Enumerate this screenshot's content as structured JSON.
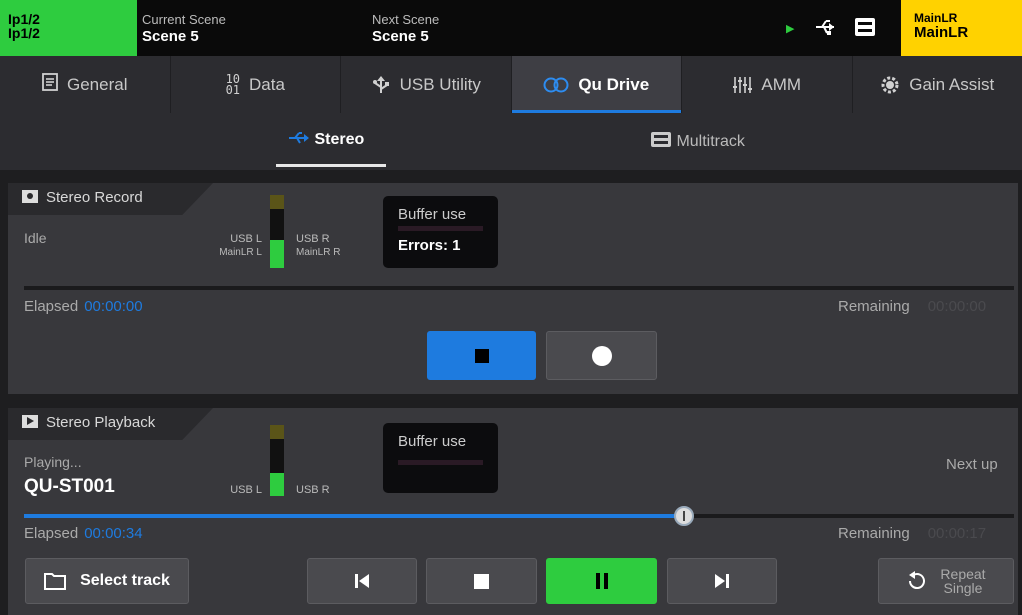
{
  "topbar": {
    "layer_line1": "Ip1/2",
    "layer_line2": "Ip1/2",
    "layer_color": "#2ecc3f",
    "current_scene_label": "Current Scene",
    "current_scene_value": "Scene 5",
    "next_scene_label": "Next Scene",
    "next_scene_value": "Scene 5",
    "status_icons": [
      "play-indicator-icon",
      "usb-icon",
      "sd-card-icon"
    ],
    "mix_line1": "MainLR",
    "mix_line2": "MainLR",
    "mix_color": "#ffd200"
  },
  "tabs": [
    {
      "label": "General",
      "icon": "document-icon",
      "glyph": "▤"
    },
    {
      "label": "Data",
      "icon": "binary-icon",
      "glyph": "¹⁰"
    },
    {
      "label": "USB Utility",
      "icon": "usb-icon",
      "glyph": "⭍"
    },
    {
      "label": "Qu Drive",
      "icon": "qu-drive-icon",
      "glyph": "◎◎",
      "active": true
    },
    {
      "label": "AMM",
      "icon": "amm-icon",
      "glyph": "⫶"
    },
    {
      "label": "Gain Assist",
      "icon": "gain-assist-icon",
      "glyph": "⚙"
    }
  ],
  "subtabs": [
    {
      "label": "Stereo",
      "icon": "usb-icon",
      "active": true
    },
    {
      "label": "Multitrack",
      "icon": "sd-card-icon"
    }
  ],
  "accent_color": "#1e7bdf",
  "record": {
    "title": "Stereo Record",
    "status": "Idle",
    "meter_left_label1": "USB L",
    "meter_left_label2": "MainLR L",
    "meter_right_label1": "USB R",
    "meter_right_label2": "MainLR R",
    "buffer_label": "Buffer use",
    "errors": "Errors: 1",
    "elapsed_label": "Elapsed",
    "elapsed_time": "00:00:00",
    "remaining_label": "Remaining",
    "remaining_time": "00:00:00"
  },
  "playback": {
    "title": "Stereo Playback",
    "status": "Playing...",
    "track_name": "QU-ST001",
    "meter_left_label": "USB L",
    "meter_right_label": "USB R",
    "buffer_label": "Buffer use",
    "next_up_label": "Next up",
    "progress": 0.667,
    "elapsed_label": "Elapsed",
    "elapsed_time": "00:00:34",
    "remaining_label": "Remaining",
    "remaining_time": "00:00:17",
    "select_track_label": "Select track",
    "repeat_label_line1": "Repeat",
    "repeat_label_line2": "Single"
  }
}
